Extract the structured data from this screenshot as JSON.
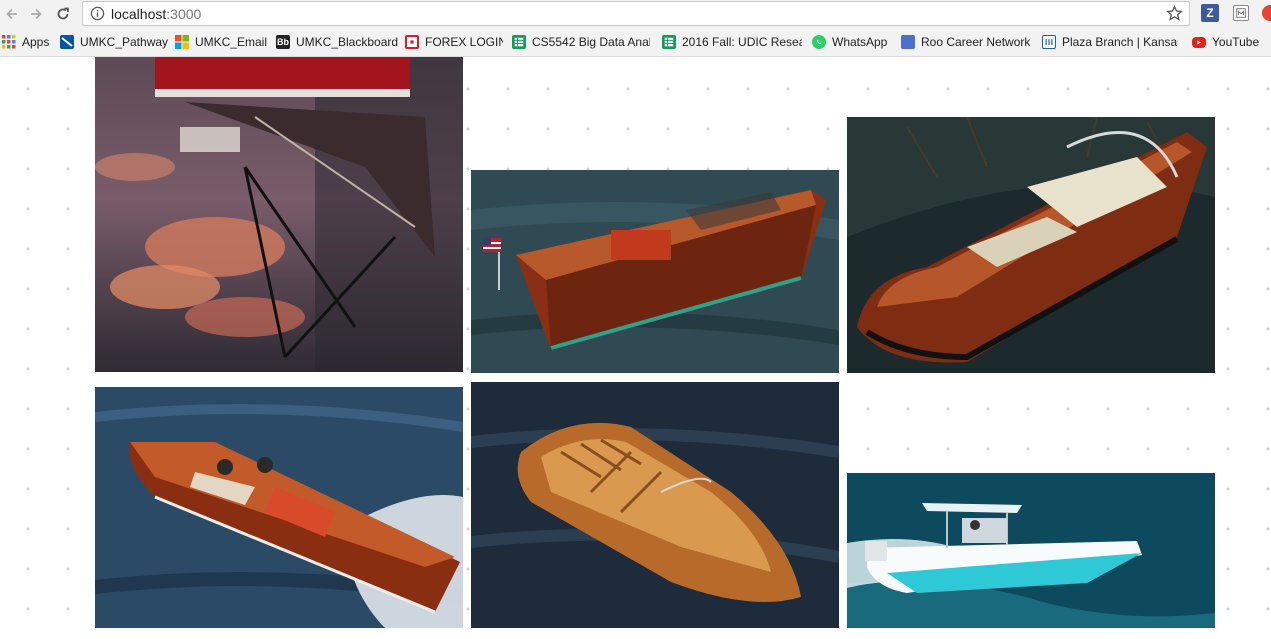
{
  "browser": {
    "url_host": "localhost",
    "url_port": ":3000"
  },
  "bookmarks": [
    {
      "label": "Apps",
      "icon": "apps-grid-icon",
      "color": "#e34234"
    },
    {
      "label": "UMKC_Pathway",
      "icon": "umkc-icon",
      "color": "#0057a3"
    },
    {
      "label": "UMKC_Email",
      "icon": "microsoft-icon",
      "color": "#f25022"
    },
    {
      "label": "UMKC_Blackboard",
      "icon": "blackboard-icon",
      "color": "#222222"
    },
    {
      "label": "FOREX LOGIN",
      "icon": "forex-icon",
      "color": "#d81e28"
    },
    {
      "label": "CS5542 Big Data Anal",
      "icon": "sheets-icon",
      "color": "#0f9d58"
    },
    {
      "label": "2016 Fall: UDIC Resea",
      "icon": "sheets-icon",
      "color": "#0f9d58"
    },
    {
      "label": "WhatsApp",
      "icon": "whatsapp-icon",
      "color": "#25d366"
    },
    {
      "label": "Roo Career Network",
      "icon": "document-icon",
      "color": "#4a6fd1"
    },
    {
      "label": "Plaza Branch | Kansas",
      "icon": "library-icon",
      "color": "#1d5aa8"
    },
    {
      "label": "YouTube",
      "icon": "youtube-icon",
      "color": "#e62117"
    }
  ],
  "gallery": [
    {
      "subject": "red hull reflected in sunset water"
    },
    {
      "subject": "mahogany runabout with american flag"
    },
    {
      "subject": "wooden speedboat with cream seats, top view"
    },
    {
      "subject": "classic wooden speedboat under way with two people"
    },
    {
      "subject": "varnished wooden boat on dark water"
    },
    {
      "subject": "white and turquoise center console boat"
    }
  ]
}
